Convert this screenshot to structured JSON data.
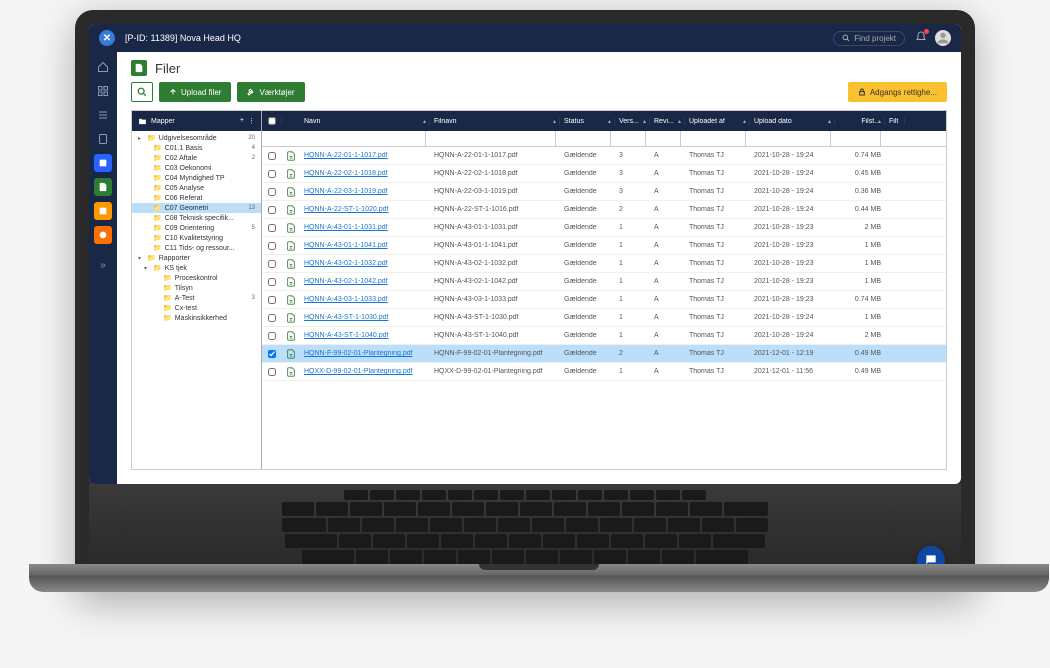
{
  "header": {
    "title": "[P-ID: 11389] Nova Head HQ",
    "search_placeholder": "Find projekt"
  },
  "page": {
    "title": "Filer"
  },
  "toolbar": {
    "upload": "Upload filer",
    "tools": "Værktøjer",
    "access": "Adgangs rettighe..."
  },
  "tree": {
    "header": "Mapper",
    "items": [
      {
        "level": 0,
        "caret": "▸",
        "icon": "📁",
        "label": "Udgivelsesområde",
        "count": "20",
        "selected": false,
        "color": "#fbc02d"
      },
      {
        "level": 1,
        "caret": "",
        "icon": "📁",
        "label": "C01.1 Basis",
        "count": "4",
        "selected": false,
        "color": "#fbc02d"
      },
      {
        "level": 1,
        "caret": "",
        "icon": "📁",
        "label": "C02 Aftale",
        "count": "2",
        "selected": false,
        "color": "#fbc02d"
      },
      {
        "level": 1,
        "caret": "",
        "icon": "📁",
        "label": "C03 Oekonomi",
        "count": "",
        "selected": false,
        "color": "#fbc02d"
      },
      {
        "level": 1,
        "caret": "",
        "icon": "📁",
        "label": "C04 Myndighed TP",
        "count": "",
        "selected": false,
        "color": "#fbc02d"
      },
      {
        "level": 1,
        "caret": "",
        "icon": "📁",
        "label": "C05 Analyse",
        "count": "",
        "selected": false,
        "color": "#fbc02d"
      },
      {
        "level": 1,
        "caret": "",
        "icon": "📁",
        "label": "C06 Referat",
        "count": "",
        "selected": false,
        "color": "#fbc02d"
      },
      {
        "level": 1,
        "caret": "",
        "icon": "📁",
        "label": "C07 Geometri",
        "count": "13",
        "selected": true,
        "color": "#fbc02d"
      },
      {
        "level": 1,
        "caret": "",
        "icon": "📁",
        "label": "C08 Teknisk specifik...",
        "count": "",
        "selected": false,
        "color": "#fbc02d"
      },
      {
        "level": 1,
        "caret": "",
        "icon": "📁",
        "label": "C09 Orientering",
        "count": "5",
        "selected": false,
        "color": "#fbc02d"
      },
      {
        "level": 1,
        "caret": "",
        "icon": "📁",
        "label": "C10 Kvalitetstyring",
        "count": "",
        "selected": false,
        "color": "#fbc02d"
      },
      {
        "level": 1,
        "caret": "",
        "icon": "📁",
        "label": "C11 Tids- og ressour...",
        "count": "",
        "selected": false,
        "color": "#fbc02d"
      },
      {
        "level": 0,
        "caret": "▾",
        "icon": "📁",
        "label": "Rapporter",
        "count": "",
        "selected": false,
        "color": "#fbc02d"
      },
      {
        "level": 1,
        "caret": "▾",
        "icon": "📁",
        "label": "KS tjek",
        "count": "",
        "selected": false,
        "color": "#fbc02d"
      },
      {
        "level": 2,
        "caret": "",
        "icon": "📁",
        "label": "Proceskontrol",
        "count": "",
        "selected": false,
        "color": "#fbc02d"
      },
      {
        "level": 2,
        "caret": "",
        "icon": "📁",
        "label": "Tilsyn",
        "count": "",
        "selected": false,
        "color": "#fbc02d"
      },
      {
        "level": 2,
        "caret": "",
        "icon": "📁",
        "label": "A-Test",
        "count": "3",
        "selected": false,
        "color": "#fbc02d"
      },
      {
        "level": 2,
        "caret": "",
        "icon": "📁",
        "label": "Cx-test",
        "count": "",
        "selected": false,
        "color": "#fbc02d"
      },
      {
        "level": 2,
        "caret": "",
        "icon": "📁",
        "label": "Maskinsikkerhed",
        "count": "",
        "selected": false,
        "color": "#fbc02d"
      }
    ]
  },
  "grid": {
    "columns": {
      "name": "Navn",
      "filename": "Filnavn",
      "status": "Status",
      "version": "Vers...",
      "revision": "Revi...",
      "uploaded_by": "Uploadet af",
      "upload_date": "Upload dato",
      "file_size": "Filst...",
      "filt": "Filt"
    },
    "rows": [
      {
        "name": "HQNN-A-22-01-1-1017.pdf",
        "filename": "HQNN-A-22-01-1-1017.pdf",
        "status": "Gældende",
        "version": "3",
        "revision": "A",
        "uploaded_by": "Thomas TJ",
        "upload_date": "2021-10-28 - 19:24",
        "size": "0.74 MB",
        "selected": false
      },
      {
        "name": "HQNN-A-22-02-1-1018.pdf",
        "filename": "HQNN-A-22-02-1-1018.pdf",
        "status": "Gældende",
        "version": "3",
        "revision": "A",
        "uploaded_by": "Thomas TJ",
        "upload_date": "2021-10-28 - 19:24",
        "size": "0.45 MB",
        "selected": false
      },
      {
        "name": "HQNN-A-22-03-1-1019.pdf",
        "filename": "HQNN-A-22-03-1-1019.pdf",
        "status": "Gældende",
        "version": "3",
        "revision": "A",
        "uploaded_by": "Thomas TJ",
        "upload_date": "2021-10-28 - 19:24",
        "size": "0.36 MB",
        "selected": false
      },
      {
        "name": "HQNN-A-22-ST-1-1020.pdf",
        "filename": "HQNN-A-22-ST-1-1016.pdf",
        "status": "Gældende",
        "version": "2",
        "revision": "A",
        "uploaded_by": "Thomas TJ",
        "upload_date": "2021-10-28 - 19:24",
        "size": "0.44 MB",
        "selected": false
      },
      {
        "name": "HQNN-A-43-01-1-1031.pdf",
        "filename": "HQNN-A-43-01-1-1031.pdf",
        "status": "Gældende",
        "version": "1",
        "revision": "A",
        "uploaded_by": "Thomas TJ",
        "upload_date": "2021-10-28 - 19:23",
        "size": "2 MB",
        "selected": false
      },
      {
        "name": "HQNN-A-43-01-1-1041.pdf",
        "filename": "HQNN-A-43-01-1-1041.pdf",
        "status": "Gældende",
        "version": "1",
        "revision": "A",
        "uploaded_by": "Thomas TJ",
        "upload_date": "2021-10-28 - 19:23",
        "size": "1 MB",
        "selected": false
      },
      {
        "name": "HQNN-A-43-02-1-1032.pdf",
        "filename": "HQNN-A-43-02-1-1032.pdf",
        "status": "Gældende",
        "version": "1",
        "revision": "A",
        "uploaded_by": "Thomas TJ",
        "upload_date": "2021-10-28 - 19:23",
        "size": "1 MB",
        "selected": false
      },
      {
        "name": "HQNN-A-43-02-1-1042.pdf",
        "filename": "HQNN-A-43-02-1-1042.pdf",
        "status": "Gældende",
        "version": "1",
        "revision": "A",
        "uploaded_by": "Thomas TJ",
        "upload_date": "2021-10-28 - 19:23",
        "size": "1 MB",
        "selected": false
      },
      {
        "name": "HQNN-A-43-03-1-1033.pdf",
        "filename": "HQNN-A-43-03-1-1033.pdf",
        "status": "Gældende",
        "version": "1",
        "revision": "A",
        "uploaded_by": "Thomas TJ",
        "upload_date": "2021-10-28 - 19:23",
        "size": "0.74 MB",
        "selected": false
      },
      {
        "name": "HQNN-A-43-ST-1-1030.pdf",
        "filename": "HQNN-A-43-ST-1-1030.pdf",
        "status": "Gældende",
        "version": "1",
        "revision": "A",
        "uploaded_by": "Thomas TJ",
        "upload_date": "2021-10-28 - 19:24",
        "size": "1 MB",
        "selected": false
      },
      {
        "name": "HQNN-A-43-ST-1-1040.pdf",
        "filename": "HQNN-A-43-ST-1-1040.pdf",
        "status": "Gældende",
        "version": "1",
        "revision": "A",
        "uploaded_by": "Thomas TJ",
        "upload_date": "2021-10-28 - 19:24",
        "size": "2 MB",
        "selected": false
      },
      {
        "name": "HQNN-F-99-02-01-Plantegning.pdf",
        "filename": "HQNN-F-99-02-01-Plantegning.pdf",
        "status": "Gældende",
        "version": "2",
        "revision": "A",
        "uploaded_by": "Thomas TJ",
        "upload_date": "2021-12-01 - 12:19",
        "size": "0.49 MB",
        "selected": true
      },
      {
        "name": "HQXX-D-99-02-01-Plantegning.pdf",
        "filename": "HQXX-D-99-02-01-Plantegning.pdf",
        "status": "Gældende",
        "version": "1",
        "revision": "A",
        "uploaded_by": "Thomas TJ",
        "upload_date": "2021-12-01 - 11:56",
        "size": "0.49 MB",
        "selected": false
      }
    ]
  }
}
